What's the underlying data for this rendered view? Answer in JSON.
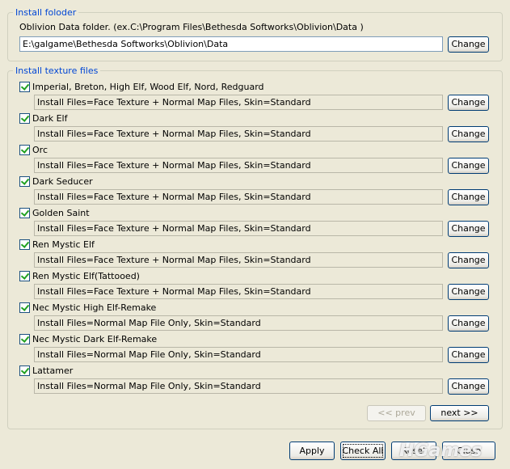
{
  "install_folder": {
    "legend": "Install foloder",
    "description": "Oblivion Data folder. (ex.C:\\Program Files\\Bethesda Softworks\\Oblivion\\Data )",
    "path": "E:\\galgame\\Bethesda Softworks\\Oblivion\\Data",
    "change_label": "Change"
  },
  "texture_files": {
    "legend": "Install texture files",
    "change_label": "Change",
    "items": [
      {
        "name": "Imperial, Breton, High Elf, Wood Elf, Nord, Redguard",
        "checked": true,
        "setting": "Install Files=Face Texture + Normal Map Files, Skin=Standard"
      },
      {
        "name": "Dark Elf",
        "checked": true,
        "setting": "Install Files=Face Texture + Normal Map Files, Skin=Standard"
      },
      {
        "name": "Orc",
        "checked": true,
        "setting": "Install Files=Face Texture + Normal Map Files, Skin=Standard"
      },
      {
        "name": "Dark Seducer",
        "checked": true,
        "setting": "Install Files=Face Texture + Normal Map Files, Skin=Standard"
      },
      {
        "name": "Golden Saint",
        "checked": true,
        "setting": "Install Files=Face Texture + Normal Map Files, Skin=Standard"
      },
      {
        "name": "Ren Mystic Elf",
        "checked": true,
        "setting": "Install Files=Face Texture + Normal Map Files, Skin=Standard"
      },
      {
        "name": "Ren Mystic Elf(Tattooed)",
        "checked": true,
        "setting": "Install Files=Face Texture + Normal Map Files, Skin=Standard"
      },
      {
        "name": "Nec Mystic High Elf-Remake",
        "checked": true,
        "setting": "Install Files=Normal Map File Only, Skin=Standard"
      },
      {
        "name": "Nec Mystic Dark Elf-Remake",
        "checked": true,
        "setting": "Install Files=Normal Map File Only, Skin=Standard"
      },
      {
        "name": "Lattamer",
        "checked": true,
        "setting": "Install Files=Normal Map File Only, Skin=Standard"
      }
    ],
    "prev_label": "<< prev",
    "next_label": "next >>"
  },
  "footer": {
    "apply_label": "Apply",
    "check_all_label": "Check All",
    "reset_label": "Reset",
    "close_label": "Close"
  },
  "watermark": "HGames"
}
